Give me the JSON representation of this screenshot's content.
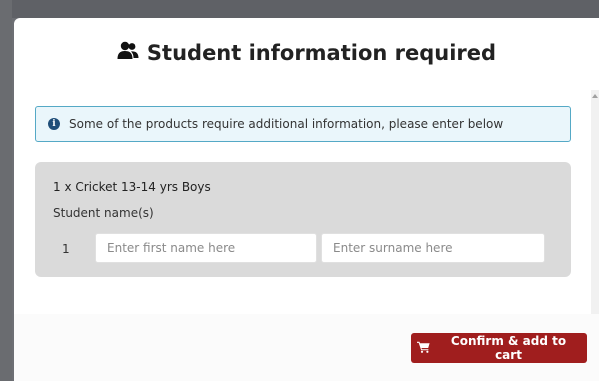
{
  "modal": {
    "title": "Student information required",
    "title_icon": "users-icon"
  },
  "info": {
    "icon": "info-circle-icon",
    "message": "Some of the products require additional information, please enter below"
  },
  "product": {
    "title": "1 x Cricket 13-14 yrs Boys",
    "student_label": "Student name(s)",
    "rows": [
      {
        "number": "1",
        "first_name_placeholder": "Enter first name here",
        "surname_placeholder": "Enter surname here"
      }
    ]
  },
  "footer": {
    "confirm_label": "Confirm & add to cart",
    "confirm_icon": "cart-icon"
  },
  "colors": {
    "primary_button": "#a01e1e",
    "info_border": "#55a9c6",
    "info_background": "#eaf6fb",
    "panel_background": "#dadada"
  }
}
